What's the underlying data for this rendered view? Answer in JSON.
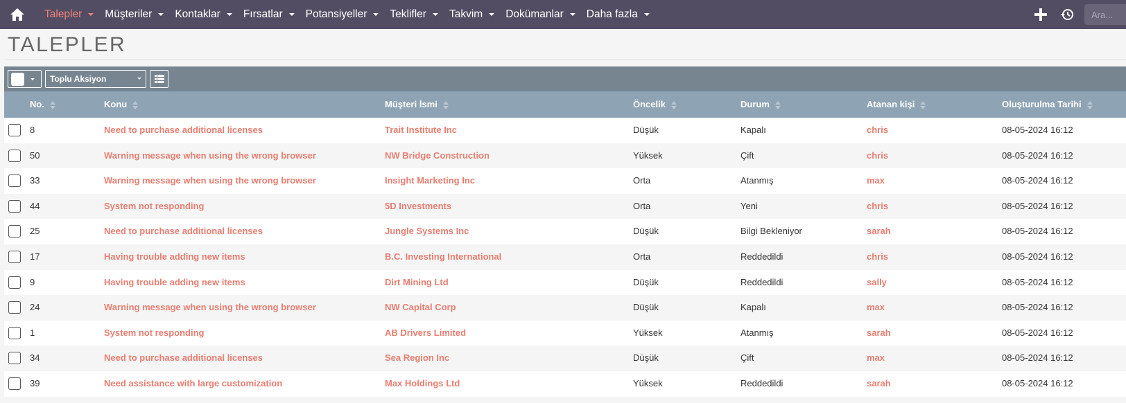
{
  "nav": {
    "items": [
      {
        "label": "Talepler",
        "active": true
      },
      {
        "label": "Müşteriler",
        "active": false
      },
      {
        "label": "Kontaklar",
        "active": false
      },
      {
        "label": "Fırsatlar",
        "active": false
      },
      {
        "label": "Potansiyeller",
        "active": false
      },
      {
        "label": "Teklifler",
        "active": false
      },
      {
        "label": "Takvim",
        "active": false
      },
      {
        "label": "Dokümanlar",
        "active": false
      },
      {
        "label": "Daha fazla",
        "active": false
      }
    ],
    "search_placeholder": "Ara...",
    "icons": [
      "home-icon",
      "plus-icon",
      "history-icon"
    ]
  },
  "page": {
    "title": "TALEPLER"
  },
  "actions": {
    "bulk_label": "Toplu Aksiyon"
  },
  "table": {
    "headers": {
      "no": "No.",
      "konu": "Konu",
      "musteri": "Müşteri İsmi",
      "oncelik": "Öncelik",
      "durum": "Durum",
      "atanan": "Atanan kişi",
      "tarih": "Oluşturulma Tarihi"
    },
    "rows": [
      {
        "no": "8",
        "konu": "Need to purchase additional licenses",
        "musteri": "Trait Institute Inc",
        "oncelik": "Düşük",
        "durum": "Kapalı",
        "atanan": "chris",
        "tarih": "08-05-2024 16:12"
      },
      {
        "no": "50",
        "konu": "Warning message when using the wrong browser",
        "musteri": "NW Bridge Construction",
        "oncelik": "Yüksek",
        "durum": "Çift",
        "atanan": "chris",
        "tarih": "08-05-2024 16:12"
      },
      {
        "no": "33",
        "konu": "Warning message when using the wrong browser",
        "musteri": "Insight Marketing Inc",
        "oncelik": "Orta",
        "durum": "Atanmış",
        "atanan": "max",
        "tarih": "08-05-2024 16:12"
      },
      {
        "no": "44",
        "konu": "System not responding",
        "musteri": "5D Investments",
        "oncelik": "Orta",
        "durum": "Yeni",
        "atanan": "chris",
        "tarih": "08-05-2024 16:12"
      },
      {
        "no": "25",
        "konu": "Need to purchase additional licenses",
        "musteri": "Jungle Systems Inc",
        "oncelik": "Düşük",
        "durum": "Bilgi Bekleniyor",
        "atanan": "sarah",
        "tarih": "08-05-2024 16:12"
      },
      {
        "no": "17",
        "konu": "Having trouble adding new items",
        "musteri": "B.C. Investing International",
        "oncelik": "Orta",
        "durum": "Reddedildi",
        "atanan": "chris",
        "tarih": "08-05-2024 16:12"
      },
      {
        "no": "9",
        "konu": "Having trouble adding new items",
        "musteri": "Dirt Mining Ltd",
        "oncelik": "Düşük",
        "durum": "Reddedildi",
        "atanan": "sally",
        "tarih": "08-05-2024 16:12"
      },
      {
        "no": "24",
        "konu": "Warning message when using the wrong browser",
        "musteri": "NW Capital Corp",
        "oncelik": "Düşük",
        "durum": "Kapalı",
        "atanan": "max",
        "tarih": "08-05-2024 16:12"
      },
      {
        "no": "1",
        "konu": "System not responding",
        "musteri": "AB Drivers Limited",
        "oncelik": "Yüksek",
        "durum": "Atanmış",
        "atanan": "sarah",
        "tarih": "08-05-2024 16:12"
      },
      {
        "no": "34",
        "konu": "Need to purchase additional licenses",
        "musteri": "Sea Region Inc",
        "oncelik": "Düşük",
        "durum": "Çift",
        "atanan": "max",
        "tarih": "08-05-2024 16:12"
      },
      {
        "no": "39",
        "konu": "Need assistance with large customization",
        "musteri": "Max Holdings Ltd",
        "oncelik": "Yüksek",
        "durum": "Reddedildi",
        "atanan": "sarah",
        "tarih": "08-05-2024 16:12"
      }
    ]
  },
  "colors": {
    "nav_bg": "#534d64",
    "accent": "#f08377",
    "link": "#e87d70",
    "actionbar_bg": "#778591",
    "header_bg": "#8ea3b4"
  }
}
